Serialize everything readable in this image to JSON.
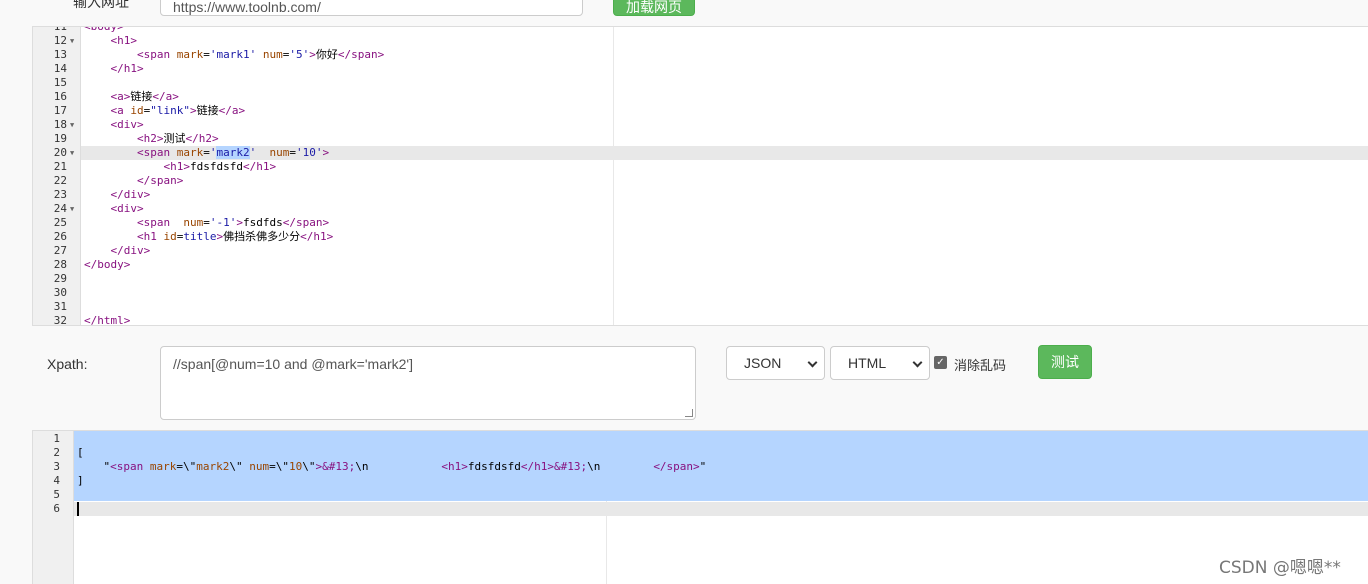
{
  "header": {
    "url_label": "输入网址",
    "url_value": "https://www.toolnb.com/",
    "load_button": "加载网页"
  },
  "source_editor": {
    "lines": [
      {
        "n": "11",
        "fold": false,
        "html": "<span class='t-tag'>&lt;body&gt;</span>"
      },
      {
        "n": "12",
        "fold": true,
        "html": "    <span class='t-tag'>&lt;h1&gt;</span>"
      },
      {
        "n": "13",
        "fold": false,
        "html": "        <span class='t-tag'>&lt;span</span> <span class='t-attr'>mark</span>=<span class='t-val'>'mark1'</span> <span class='t-attr'>num</span>=<span class='t-val'>'5'</span><span class='t-tag'>&gt;</span>你好<span class='t-tag'>&lt;/span&gt;</span>"
      },
      {
        "n": "14",
        "fold": false,
        "html": "    <span class='t-tag'>&lt;/h1&gt;</span>"
      },
      {
        "n": "15",
        "fold": false,
        "html": ""
      },
      {
        "n": "16",
        "fold": false,
        "html": "    <span class='t-tag'>&lt;a&gt;</span>链接<span class='t-tag'>&lt;/a&gt;</span>"
      },
      {
        "n": "17",
        "fold": false,
        "html": "    <span class='t-tag'>&lt;a</span> <span class='t-attr'>id</span>=<span class='t-val'>\"link\"</span><span class='t-tag'>&gt;</span>链接<span class='t-tag'>&lt;/a&gt;</span>"
      },
      {
        "n": "18",
        "fold": true,
        "html": "    <span class='t-tag'>&lt;div&gt;</span>"
      },
      {
        "n": "19",
        "fold": false,
        "html": "        <span class='t-tag'>&lt;h2&gt;</span>测试<span class='t-tag'>&lt;/h2&gt;</span>"
      },
      {
        "n": "20",
        "fold": true,
        "html": "        <span class='t-tag'>&lt;span</span> <span class='t-attr'>mark</span>=<span class='t-val'>'<span class='t-sel'>mark2</span>'</span>  <span class='t-attr'>num</span>=<span class='t-val'>'10'</span><span class='t-tag'>&gt;</span>",
        "active": true
      },
      {
        "n": "21",
        "fold": false,
        "html": "            <span class='t-tag'>&lt;h1&gt;</span>fdsfdsfd<span class='t-tag'>&lt;/h1&gt;</span>"
      },
      {
        "n": "22",
        "fold": false,
        "html": "        <span class='t-tag'>&lt;/span&gt;</span>"
      },
      {
        "n": "23",
        "fold": false,
        "html": "    <span class='t-tag'>&lt;/div&gt;</span>"
      },
      {
        "n": "24",
        "fold": true,
        "html": "    <span class='t-tag'>&lt;div&gt;</span>"
      },
      {
        "n": "25",
        "fold": false,
        "html": "        <span class='t-tag'>&lt;span</span>  <span class='t-attr'>num</span>=<span class='t-val'>'-1'</span><span class='t-tag'>&gt;</span>fsdfds<span class='t-tag'>&lt;/span&gt;</span>"
      },
      {
        "n": "26",
        "fold": false,
        "html": "        <span class='t-tag'>&lt;h1</span> <span class='t-attr'>id</span>=<span class='t-val'>title</span><span class='t-tag'>&gt;</span>佛挡杀佛多少分<span class='t-tag'>&lt;/h1&gt;</span>"
      },
      {
        "n": "27",
        "fold": false,
        "html": "    <span class='t-tag'>&lt;/div&gt;</span>"
      },
      {
        "n": "28",
        "fold": false,
        "html": "<span class='t-tag'>&lt;/body&gt;</span>"
      },
      {
        "n": "29",
        "fold": false,
        "html": ""
      },
      {
        "n": "30",
        "fold": false,
        "html": ""
      },
      {
        "n": "31",
        "fold": false,
        "html": ""
      },
      {
        "n": "32",
        "fold": false,
        "html": "<span class='t-tag'>&lt;/html&gt;</span>"
      }
    ]
  },
  "xpath": {
    "label": "Xpath:",
    "value": "//span[@num=10 and @mark='mark2']",
    "format_select": "JSON",
    "type_select": "HTML",
    "clean_checkbox_label": "消除乱码",
    "clean_checked": true,
    "test_button": "测试"
  },
  "result_editor": {
    "lines": [
      {
        "n": "1",
        "html": ""
      },
      {
        "n": "2",
        "html": "["
      },
      {
        "n": "3",
        "html": "    \"<span class='t-tag'>&lt;span</span> <span class='t-attr'>mark</span>=\\\"<span class='t-attr'>mark2</span>\\\" <span class='t-attr'>num</span>=\\\"<span class='t-attr'>10</span>\\\"<span class='t-tag'>&gt;</span><span class='t-ent'>&amp;#13;</span>\\n           <span class='t-tag'>&lt;h1&gt;</span>fdsfdsfd<span class='t-tag'>&lt;/h1&gt;</span><span class='t-ent'>&amp;#13;</span>\\n        <span class='t-tag'>&lt;/span&gt;</span>\""
      },
      {
        "n": "4",
        "html": "]"
      },
      {
        "n": "5",
        "html": ""
      },
      {
        "n": "6",
        "html": ""
      }
    ]
  },
  "watermark": "CSDN @嗯嗯**"
}
